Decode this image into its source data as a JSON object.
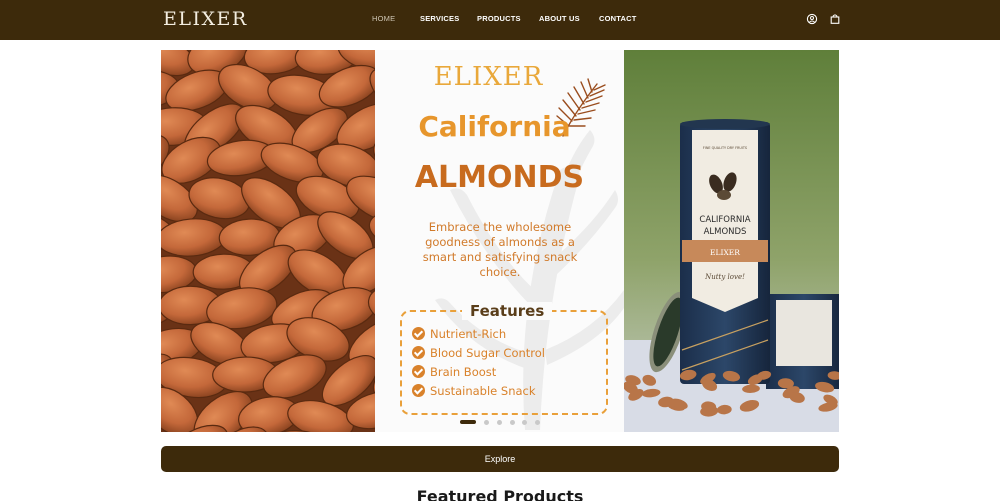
{
  "header": {
    "logo": "ELIXER",
    "nav": [
      {
        "label": "HOME",
        "active": true
      },
      {
        "label": "SERVICES",
        "active": false
      },
      {
        "label": "PRODUCTS",
        "active": false
      },
      {
        "label": "ABOUT US",
        "active": false
      },
      {
        "label": "CONTACT",
        "active": false
      }
    ],
    "icons": [
      "user-icon",
      "shopping-bag-icon"
    ]
  },
  "hero": {
    "brand": "ELIXER",
    "title_line1": "California",
    "title_line2": "ALMONDS",
    "description": "Embrace the wholesome goodness of almonds as a smart and satisfying snack choice.",
    "features_title": "Features",
    "features": [
      "Nutrient-Rich",
      "Blood Sugar Control",
      "Brain Boost",
      "Sustainable Snack"
    ],
    "can_label_top": "FINE QUALITY DRY FRUITS",
    "can_label_line1": "CALIFORNIA",
    "can_label_line2": "ALMONDS",
    "can_brand": "ELIXER",
    "can_tagline": "Nutty love!",
    "slide_count": 6,
    "active_slide": 1
  },
  "explore_label": "Explore",
  "featured_heading": "Featured Products",
  "colors": {
    "header_bg": "#3d2a0b",
    "accent_orange": "#e7962c",
    "accent_dark_orange": "#c86b1e"
  }
}
